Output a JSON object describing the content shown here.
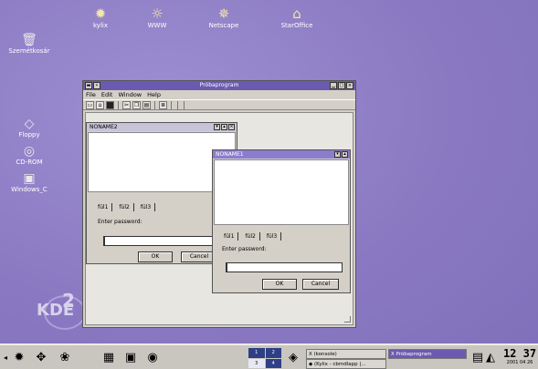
{
  "desktop": {
    "top_icons": [
      {
        "label": "kylix",
        "icon": "kylix-icon",
        "glyph": "✹"
      },
      {
        "label": "WWW",
        "icon": "www-globe-icon",
        "glyph": "☼"
      },
      {
        "label": "Netscape",
        "icon": "netscape-icon",
        "glyph": "✵"
      },
      {
        "label": "StarOffice",
        "icon": "staroffice-icon",
        "glyph": "⌂"
      }
    ],
    "side_icons": [
      {
        "label": "Szemétkosár",
        "icon": "trash-icon",
        "glyph": "🗑"
      },
      {
        "label": "Floppy",
        "icon": "floppy-icon",
        "glyph": "◇"
      },
      {
        "label": "CD-ROM",
        "icon": "cdrom-icon",
        "glyph": "◎"
      },
      {
        "label": "Windows_C",
        "icon": "harddisk-icon",
        "glyph": "▣"
      }
    ],
    "logo_text": "KDE",
    "logo_number": "2"
  },
  "main_window": {
    "title": "Próbaprogram",
    "menu": [
      "File",
      "Edit",
      "Window",
      "Help"
    ],
    "children": [
      {
        "title": "NONAME2",
        "tabs": [
          "fül1",
          "fül2",
          "fül3"
        ],
        "password_label": "Enter password:",
        "ok_label": "OK",
        "cancel_label": "Cancel"
      },
      {
        "title": "NONAME1",
        "tabs": [
          "fül1",
          "fül2",
          "fül3"
        ],
        "password_label": "Enter password:",
        "ok_label": "OK",
        "cancel_label": "Cancel"
      }
    ]
  },
  "taskbar": {
    "pager": [
      "1",
      "2",
      "3",
      "4"
    ],
    "tasks": [
      {
        "label": "(konsole)",
        "active": false
      },
      {
        "label": "(Kylix - cbmdlapp |...",
        "active": false
      },
      {
        "label": "Próbaprogram",
        "active": true
      }
    ],
    "clock_time": "12 37",
    "clock_date": "2001 04 26"
  },
  "colors": {
    "desktop": "#8f7fc6",
    "titlebar_active": "#6c5ab0",
    "taskbar": "#c9c6c0"
  }
}
